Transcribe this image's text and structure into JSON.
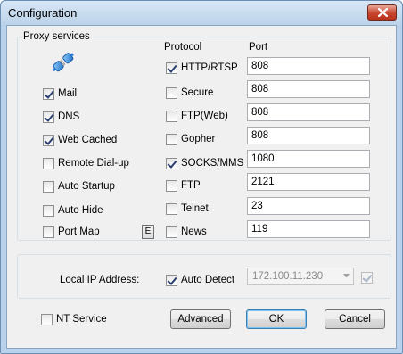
{
  "window": {
    "title": "Configuration"
  },
  "proxy": {
    "legend": "Proxy services",
    "protocol_header": "Protocol",
    "port_header": "Port",
    "services": [
      {
        "label": "Mail",
        "checked": true
      },
      {
        "label": "DNS",
        "checked": true
      },
      {
        "label": "Web Cached",
        "checked": true
      },
      {
        "label": "Remote Dial-up",
        "checked": false
      },
      {
        "label": "Auto Startup",
        "checked": false
      },
      {
        "label": "Auto Hide",
        "checked": false
      },
      {
        "label": "Port Map",
        "checked": false
      }
    ],
    "portmap_edit_label": "E",
    "protocols": [
      {
        "label": "HTTP/RTSP",
        "checked": true,
        "port": "808"
      },
      {
        "label": "Secure",
        "checked": false,
        "port": "808"
      },
      {
        "label": "FTP(Web)",
        "checked": false,
        "port": "808"
      },
      {
        "label": "Gopher",
        "checked": false,
        "port": "808"
      },
      {
        "label": "SOCKS/MMS",
        "checked": true,
        "port": "1080"
      },
      {
        "label": "FTP",
        "checked": false,
        "port": "2121"
      },
      {
        "label": "Telnet",
        "checked": false,
        "port": "23"
      },
      {
        "label": "News",
        "checked": false,
        "port": "119"
      }
    ]
  },
  "local": {
    "label": "Local IP Address:",
    "auto_detect_label": "Auto Detect",
    "auto_detect_checked": true,
    "ip_value": "172.100.11.230",
    "extra_checked": true
  },
  "footer": {
    "nt_service_label": "NT Service",
    "nt_service_checked": false,
    "advanced_label": "Advanced",
    "ok_label": "OK",
    "cancel_label": "Cancel"
  },
  "icons": {
    "close": "close-icon",
    "plug": "plug-icon",
    "dropdown": "chevron-down-icon"
  }
}
